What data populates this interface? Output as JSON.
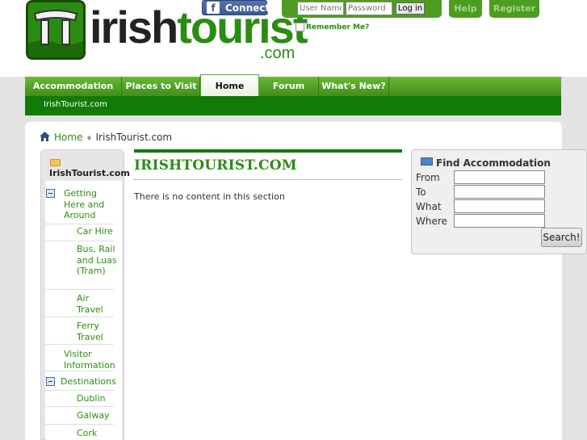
{
  "brand": {
    "name_part1": "irish",
    "name_part2": "tourist",
    "suffix": ".com"
  },
  "header": {
    "facebook_connect": "Connect",
    "facebook_glyph": "f",
    "login": {
      "username_placeholder": "User Name",
      "password_placeholder": "Password",
      "login_button": "Log in",
      "remember_me": "Remember Me?"
    },
    "help": "Help",
    "register": "Register"
  },
  "nav": {
    "items": [
      {
        "label": "Accommodation"
      },
      {
        "label": "Places to Visit"
      },
      {
        "label": "Home",
        "active": true
      },
      {
        "label": "Forum"
      },
      {
        "label": "What's New?"
      }
    ],
    "subnav": "IrishTourist.com"
  },
  "breadcrumb": {
    "home": "Home",
    "current": "IrishTourist.com"
  },
  "sidebar": {
    "title": "IrishTourist.com",
    "items": [
      {
        "label": "Getting Here and Around"
      },
      {
        "label": "Car Hire"
      },
      {
        "label": "Bus, Rail and Luas (Tram)"
      },
      {
        "label": "Air Travel"
      },
      {
        "label": "Ferry Travel"
      },
      {
        "label": "Visitor Information"
      },
      {
        "label": "Destinations"
      },
      {
        "label": "Dublin"
      },
      {
        "label": "Galway"
      },
      {
        "label": "Cork"
      }
    ]
  },
  "main": {
    "title": "IRISHTOURIST.COM",
    "message": "There is no content in this section"
  },
  "find_accommodation": {
    "title": "Find Accommodation",
    "fields": [
      {
        "label": "From"
      },
      {
        "label": "To"
      },
      {
        "label": "What"
      },
      {
        "label": "Where"
      }
    ],
    "search_button": "Search!"
  },
  "colors": {
    "brand_green": "#2a8d12",
    "nav_green": "#4d9d21",
    "dark_green": "#127a06",
    "facebook_blue": "#3b5998"
  }
}
